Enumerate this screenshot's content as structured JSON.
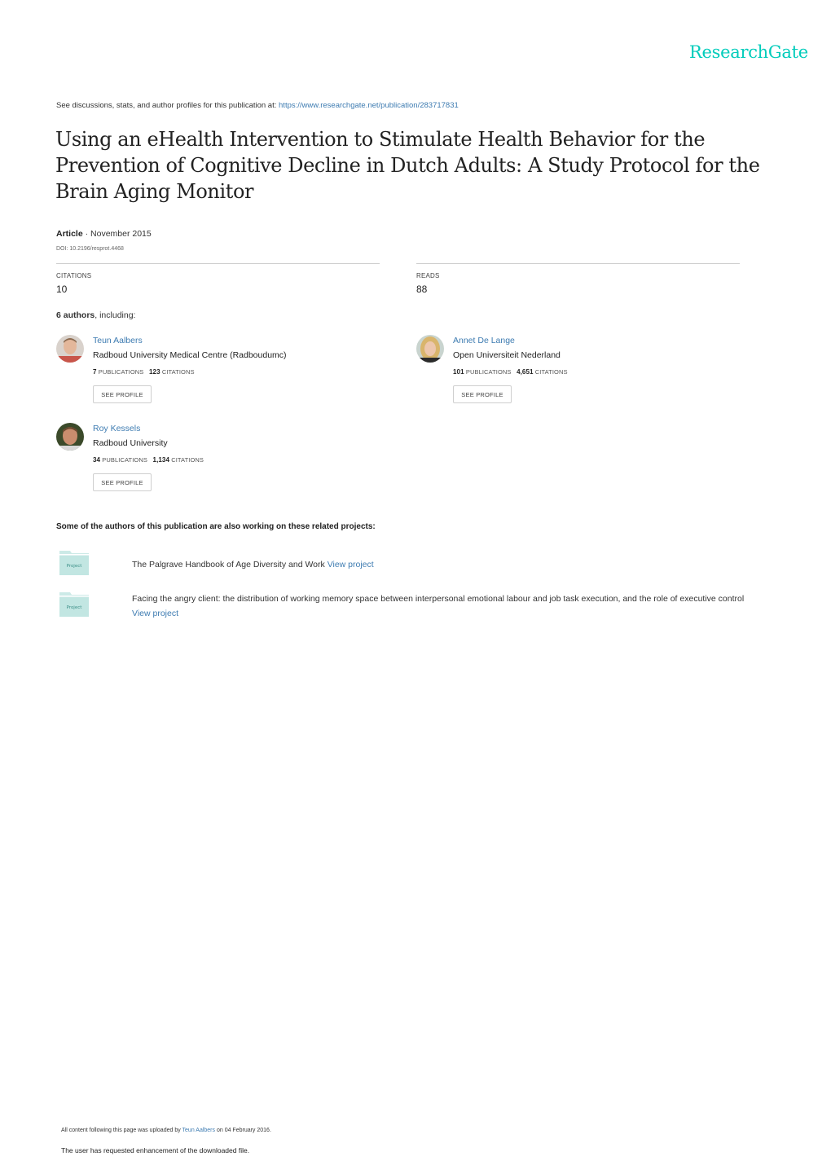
{
  "brand": {
    "logo_text": "ResearchGate",
    "accent_color": "#00ccbb",
    "link_color": "#3d7bb1"
  },
  "header": {
    "see_prefix": "See discussions, stats, and author profiles for this publication at: ",
    "publication_url": "https://www.researchgate.net/publication/283717831"
  },
  "publication": {
    "title": "Using an eHealth Intervention to Stimulate Health Behavior for the Prevention of Cognitive Decline in Dutch Adults: A Study Protocol for the Brain Aging Monitor",
    "type": "Article",
    "separator": " · ",
    "date": "November 2015",
    "doi": "DOI: 10.2196/resprot.4468"
  },
  "stats": {
    "citations_label": "CITATIONS",
    "citations_value": "10",
    "reads_label": "READS",
    "reads_value": "88"
  },
  "authors_summary": {
    "count": "6 authors",
    "suffix": ", including:"
  },
  "authors": [
    {
      "name": "Teun Aalbers",
      "institution": "Radboud University Medical Centre (Radboudumc)",
      "publications": "7",
      "publications_label": "PUBLICATIONS",
      "citations": "123",
      "citations_label": "CITATIONS",
      "button": "SEE PROFILE"
    },
    {
      "name": "Annet De Lange",
      "institution": "Open Universiteit Nederland",
      "publications": "101",
      "publications_label": "PUBLICATIONS",
      "citations": "4,651",
      "citations_label": "CITATIONS",
      "button": "SEE PROFILE"
    },
    {
      "name": "Roy Kessels",
      "institution": "Radboud University",
      "publications": "34",
      "publications_label": "PUBLICATIONS",
      "citations": "1,134",
      "citations_label": "CITATIONS",
      "button": "SEE PROFILE"
    }
  ],
  "related": {
    "heading": "Some of the authors of this publication are also working on these related projects:",
    "projects": [
      {
        "icon_label": "Project",
        "title": "The Palgrave Handbook of Age Diversity and Work ",
        "link": "View project"
      },
      {
        "icon_label": "Project",
        "title": "Facing the angry client: the distribution of working memory space between interpersonal emotional labour and job task execution, and the role of executive control",
        "link": "View project"
      }
    ]
  },
  "footer": {
    "upload_prefix": "All content following this page was uploaded by ",
    "uploader": "Teun Aalbers",
    "upload_suffix": " on 04 February 2016.",
    "enhancement_note": "The user has requested enhancement of the downloaded file."
  }
}
